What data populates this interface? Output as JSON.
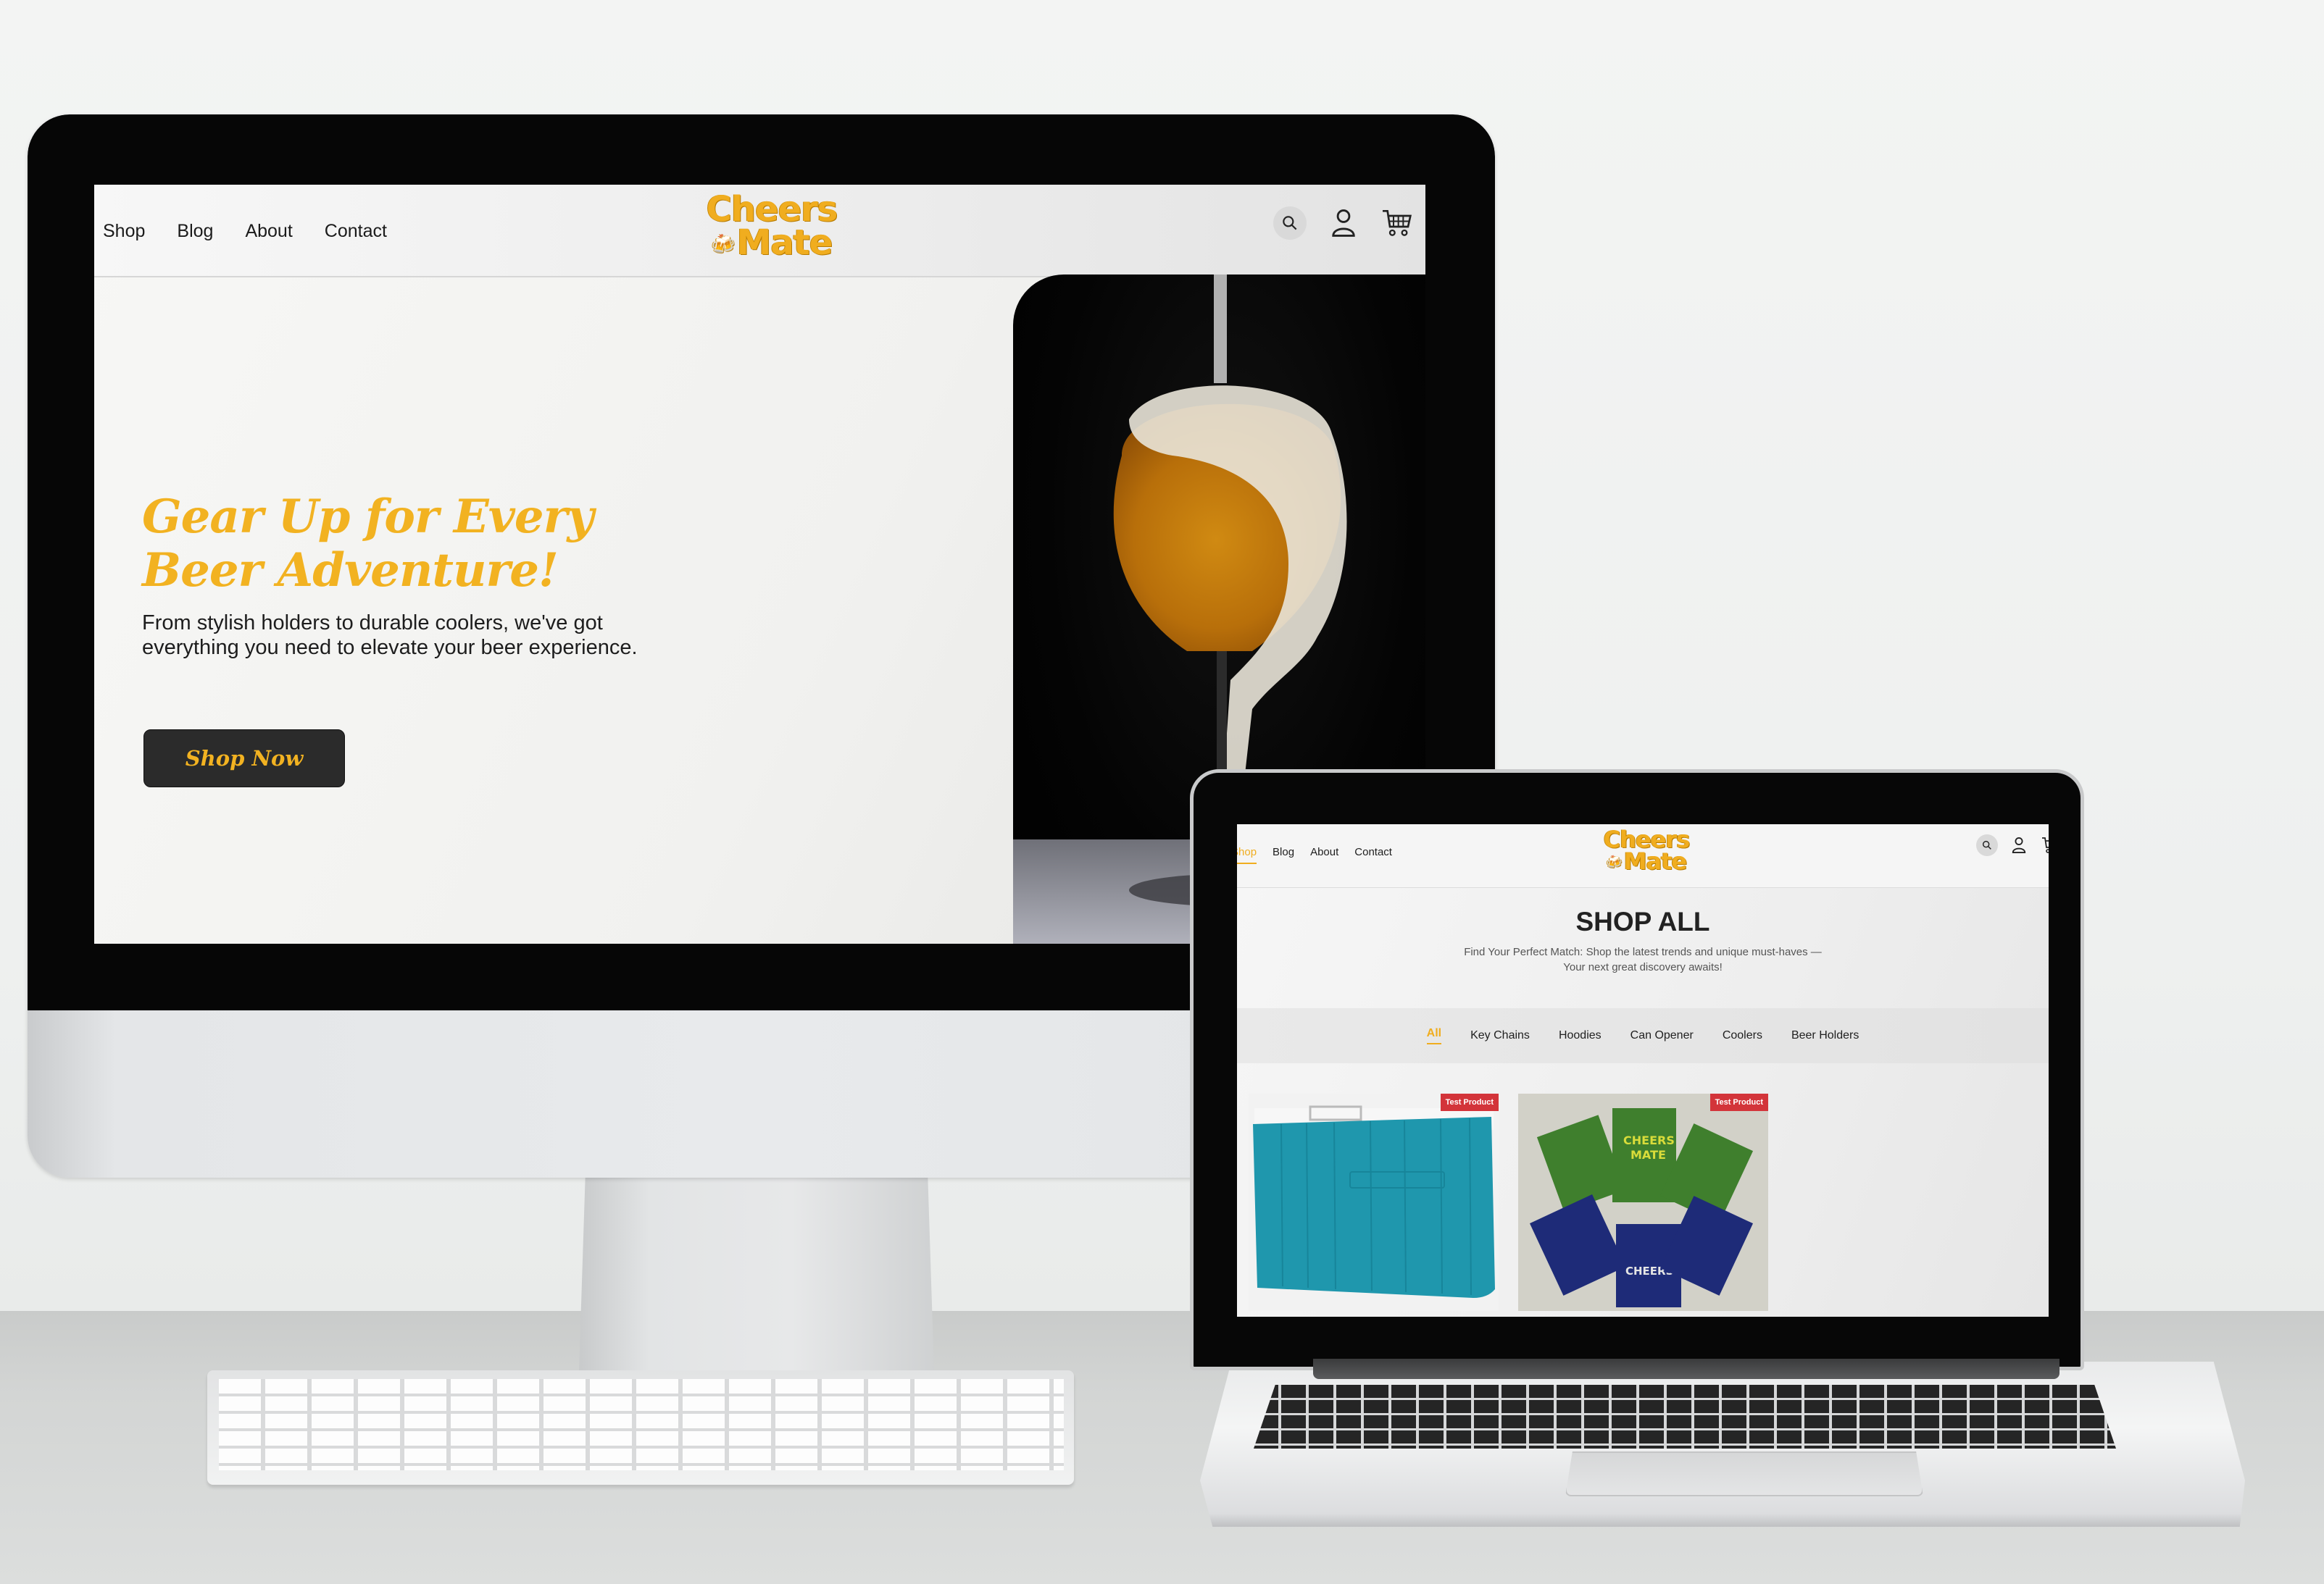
{
  "desktop_site": {
    "nav": {
      "links": [
        "Shop",
        "Blog",
        "About",
        "Contact"
      ],
      "logo_line1": "Cheers",
      "logo_line2": "Mate",
      "icons": [
        "search-icon",
        "user-icon",
        "cart-icon"
      ]
    },
    "hero": {
      "title": "Gear Up for Every Beer Adventure!",
      "subtitle": "From stylish holders to durable coolers, we've got everything you need to elevate your beer experience.",
      "cta_label": "Shop Now",
      "image_alt": "Beer pouring into glass with foam"
    }
  },
  "laptop_site": {
    "nav": {
      "links": [
        "Shop",
        "Blog",
        "About",
        "Contact"
      ],
      "active_link": "Shop",
      "logo_line1": "Cheers",
      "logo_line2": "Mate",
      "icons": [
        "search-icon",
        "user-icon",
        "cart-icon"
      ]
    },
    "page_title": "SHOP ALL",
    "page_subtitle_line1": "Find Your Perfect Match: Shop the latest trends and unique must-haves —",
    "page_subtitle_line2": "Your next great discovery awaits!",
    "filters": [
      "All",
      "Key Chains",
      "Hoodies",
      "Can Opener",
      "Coolers",
      "Beer Holders"
    ],
    "active_filter": "All",
    "products": [
      {
        "image": "Blue cooler",
        "badge": "Test Product"
      },
      {
        "image": "Cheers Mate / G'Day Mate can holders",
        "badge": "Test Product"
      }
    ]
  },
  "colors": {
    "brand_yellow": "#f2b221",
    "button_dark": "#2b2b2b",
    "badge_red": "#d3343a"
  }
}
